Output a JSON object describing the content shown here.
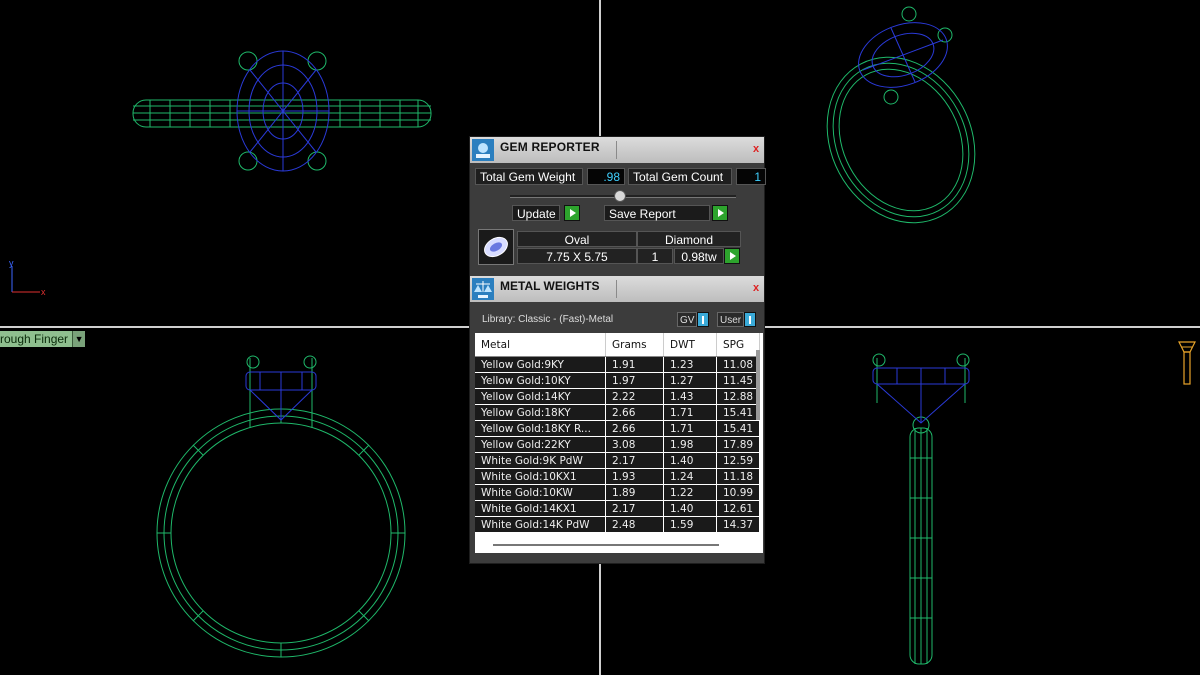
{
  "view_dropdown": {
    "label": "rough Finger"
  },
  "axis": {
    "y": "y",
    "x": "x"
  },
  "gem_reporter": {
    "title": "GEM REPORTER",
    "close": "x",
    "total_gem_weight_label": "Total Gem Weight",
    "total_gem_weight_value": ".98",
    "total_gem_count_label": "Total Gem Count",
    "total_gem_count_value": "1",
    "update_label": "Update",
    "save_report_label": "Save Report",
    "gem": {
      "shape": "Oval",
      "type": "Diamond",
      "size": "7.75 X 5.75",
      "count": "1",
      "weight": "0.98tw"
    }
  },
  "metal_weights": {
    "title": "METAL WEIGHTS",
    "close": "x",
    "library": "Library: Classic - (Fast)-Metal",
    "toggle_gv": "GV",
    "toggle_user": "User",
    "columns": [
      "Metal",
      "Grams",
      "DWT",
      "SPG"
    ],
    "rows": [
      [
        "Yellow Gold:9KY",
        "1.91",
        "1.23",
        "11.08"
      ],
      [
        "Yellow Gold:10KY",
        "1.97",
        "1.27",
        "11.45"
      ],
      [
        "Yellow Gold:14KY",
        "2.22",
        "1.43",
        "12.88"
      ],
      [
        "Yellow Gold:18KY",
        "2.66",
        "1.71",
        "15.41"
      ],
      [
        "Yellow Gold:18KY R...",
        "2.66",
        "1.71",
        "15.41"
      ],
      [
        "Yellow Gold:22KY",
        "3.08",
        "1.98",
        "17.89"
      ],
      [
        "White Gold:9K PdW",
        "2.17",
        "1.40",
        "12.59"
      ],
      [
        "White Gold:10KX1",
        "1.93",
        "1.24",
        "11.18"
      ],
      [
        "White Gold:10KW",
        "1.89",
        "1.22",
        "10.99"
      ],
      [
        "White Gold:14KX1",
        "2.17",
        "1.40",
        "12.61"
      ],
      [
        "White Gold:14K PdW",
        "2.48",
        "1.59",
        "14.37"
      ]
    ]
  },
  "colors": {
    "wire": "#1fb86a",
    "gem": "#2a3ad8",
    "panel": "#3c3c3c",
    "accent_value": "#3fd0ff",
    "go_button": "#2da42d"
  },
  "icons": [
    "gem-reporter-icon",
    "metal-weights-icon",
    "viewcube-icon",
    "axis-gizmo-icon",
    "oval-gem-icon",
    "play-arrow-icon"
  ]
}
